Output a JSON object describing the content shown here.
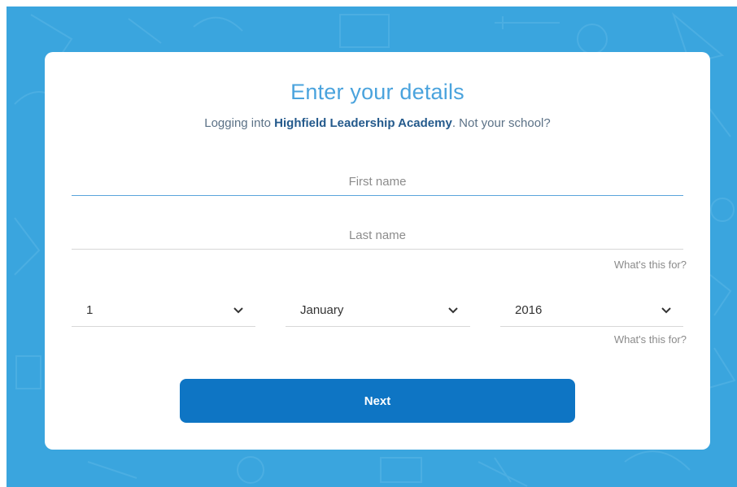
{
  "header": {
    "title": "Enter your details",
    "subtitle_prefix": "Logging into ",
    "school_name": "Highfield Leadership Academy",
    "subtitle_suffix": ". ",
    "not_your_school": "Not your school?"
  },
  "form": {
    "first_name": {
      "placeholder": "First name",
      "value": ""
    },
    "last_name": {
      "placeholder": "Last name",
      "value": ""
    },
    "name_help": "What's this for?",
    "dob": {
      "day": "1",
      "month": "January",
      "year": "2016"
    },
    "dob_help": "What's this for?",
    "next_label": "Next"
  },
  "colors": {
    "background": "#3aa5de",
    "title": "#4aa3dd",
    "school_name": "#245a8c",
    "button": "#0e75c4",
    "active_underline": "#5aa4dc"
  },
  "icons": {
    "select_chevron": "chevron-down-icon"
  }
}
